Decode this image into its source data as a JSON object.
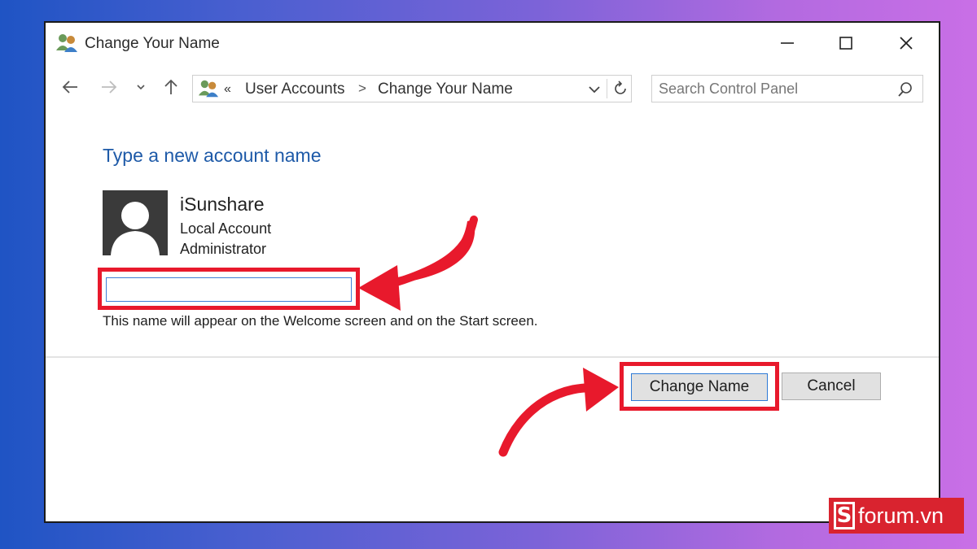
{
  "window": {
    "title": "Change Your Name",
    "title_icon": "user-accounts-icon",
    "controls": {
      "minimize": "minimize-icon",
      "maximize": "maximize-icon",
      "close": "close-icon"
    }
  },
  "navigation": {
    "back_icon": "back-arrow-icon",
    "forward_icon": "forward-arrow-icon",
    "recent_icon": "chevron-down-icon",
    "up_icon": "up-arrow-icon",
    "address": {
      "icon": "user-accounts-icon",
      "overflow": "«",
      "breadcrumbs": [
        "User Accounts",
        "Change Your Name"
      ],
      "separator": ">"
    },
    "search": {
      "placeholder": "Search Control Panel",
      "value": ""
    }
  },
  "content": {
    "heading": "Type a new account name",
    "account": {
      "name": "iSunshare",
      "type": "Local Account",
      "role": "Administrator"
    },
    "new_name": {
      "value": "",
      "placeholder": ""
    },
    "hint": "This name will appear on the Welcome screen and on the Start screen."
  },
  "buttons": {
    "change_name": "Change Name",
    "cancel": "Cancel"
  },
  "annotations": {
    "highlight_color": "#e8192c",
    "accent_color": "#1e5aa8"
  },
  "watermark": {
    "logo": "S",
    "text": "forum.vn",
    "background": "#d9232f"
  }
}
